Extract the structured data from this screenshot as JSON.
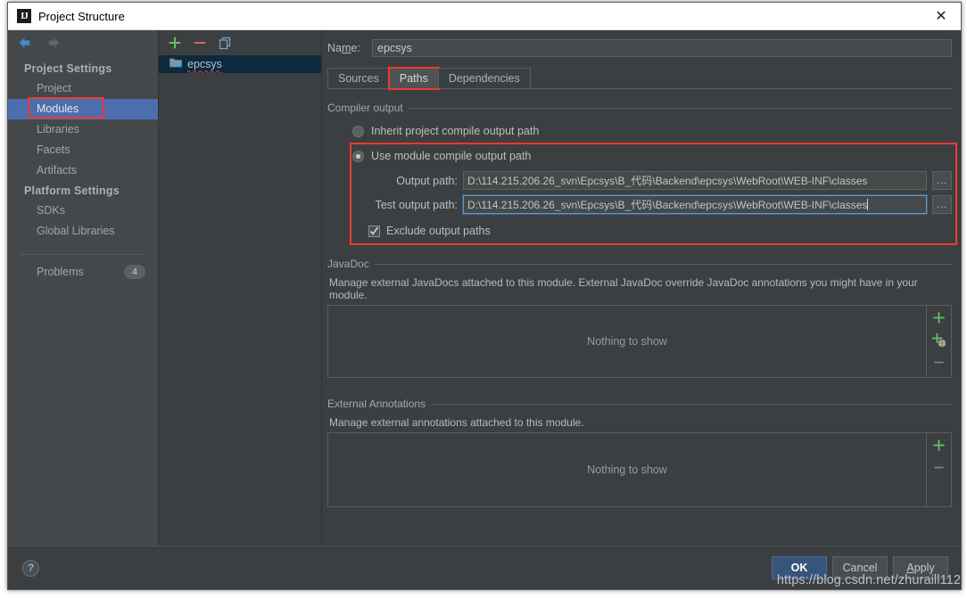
{
  "window": {
    "title": "Project Structure",
    "title_icon": "intellij-idea-icon",
    "close_label": "✕"
  },
  "sidebar": {
    "nav": {
      "back": "back-arrow",
      "forward": "forward-arrow"
    },
    "groups": [
      {
        "title": "Project Settings",
        "items": [
          {
            "label": "Project",
            "selected": false
          },
          {
            "label": "Modules",
            "selected": true,
            "highlighted": true
          },
          {
            "label": "Libraries",
            "selected": false
          },
          {
            "label": "Facets",
            "selected": false
          },
          {
            "label": "Artifacts",
            "selected": false
          }
        ]
      },
      {
        "title": "Platform Settings",
        "items": [
          {
            "label": "SDKs",
            "selected": false
          },
          {
            "label": "Global Libraries",
            "selected": false
          }
        ]
      }
    ],
    "problems": {
      "label": "Problems",
      "count": "4"
    }
  },
  "module_list": {
    "toolbar": [
      {
        "name": "add-module-button",
        "glyph": "+"
      },
      {
        "name": "remove-module-button",
        "glyph": "−"
      },
      {
        "name": "copy-module-button",
        "glyph": "copy"
      }
    ],
    "items": [
      {
        "label": "epcsys",
        "selected": true,
        "has_error_underline": true
      }
    ]
  },
  "content": {
    "name_field": {
      "label": "Name:",
      "label_mnemonic": "m",
      "value": "epcsys"
    },
    "tabs": [
      {
        "label": "Sources",
        "active": false,
        "highlighted": false
      },
      {
        "label": "Paths",
        "active": true,
        "highlighted": true
      },
      {
        "label": "Dependencies",
        "active": false,
        "highlighted": false
      }
    ],
    "compiler_output": {
      "legend": "Compiler output",
      "radio_inherit": {
        "label": "Inherit project compile output path",
        "checked": false
      },
      "radio_module": {
        "label": "Use module compile output path",
        "checked": true
      },
      "output_path": {
        "label": "Output path:",
        "value": "D:\\114.215.206.26_svn\\Epcsys\\B_代码\\Backend\\epcsys\\WebRoot\\WEB-INF\\classes",
        "focused": false,
        "browse_label": "..."
      },
      "test_output_path": {
        "label": "Test output path:",
        "value": "D:\\114.215.206.26_svn\\Epcsys\\B_代码\\Backend\\epcsys\\WebRoot\\WEB-INF\\classes",
        "focused": true,
        "browse_label": "..."
      },
      "exclude_checkbox": {
        "label": "Exclude output paths",
        "checked": true
      }
    },
    "javadoc": {
      "legend": "JavaDoc",
      "description": "Manage external JavaDocs attached to this module. External JavaDoc override JavaDoc annotations you might have in your module.",
      "empty_text": "Nothing to show",
      "buttons": [
        {
          "name": "add-javadoc-button",
          "glyph": "+"
        },
        {
          "name": "add-javadoc-url-button",
          "glyph": "+globe"
        },
        {
          "name": "remove-javadoc-button",
          "glyph": "−"
        }
      ]
    },
    "external_annotations": {
      "legend": "External Annotations",
      "description": "Manage external annotations attached to this module.",
      "empty_text": "Nothing to show",
      "buttons": [
        {
          "name": "add-annotation-button",
          "glyph": "+"
        },
        {
          "name": "remove-annotation-button",
          "glyph": "−"
        }
      ]
    }
  },
  "footer": {
    "help_label": "?",
    "ok_label": "OK",
    "cancel_label": "Cancel",
    "apply_label": "Apply"
  },
  "watermark": "https://blog.csdn.net/zhuraill112",
  "colors": {
    "accent_red": "#f03a2e",
    "selection_blue": "#4b6eaf",
    "ok_button_blue": "#39547c",
    "panel_bg": "#3c3f41",
    "sidebar_bg": "#45484a"
  }
}
